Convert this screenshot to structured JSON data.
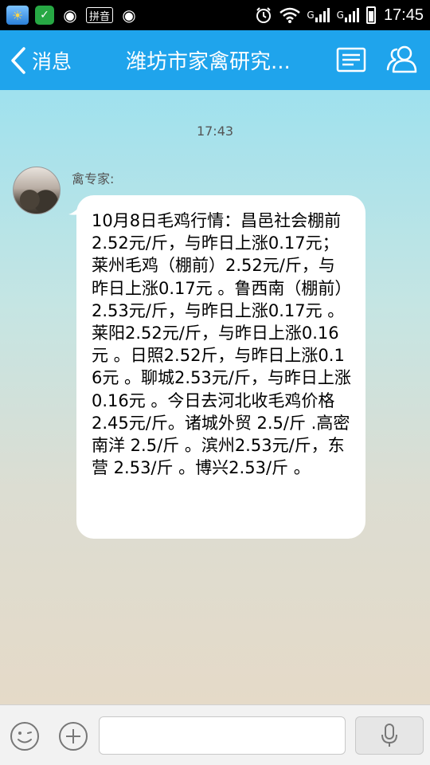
{
  "status_bar": {
    "ime_label": "拼音",
    "network_label_1": "G",
    "network_label_2": "G",
    "time": "17:45"
  },
  "header": {
    "back_label": "消息",
    "title": "潍坊市家禽研究...",
    "icons": [
      "profile-card-icon",
      "group-members-icon"
    ]
  },
  "chat": {
    "timestamp": "17:43",
    "messages": [
      {
        "sender": "禽专家:",
        "text": "10月8日毛鸡行情：昌邑社会棚前2.52元/斤，与昨日上涨0.17元；莱州毛鸡（棚前）2.52元/斤，与昨日上涨0.17元 。鲁西南（棚前）2.53元/斤，与昨日上涨0.17元 。莱阳2.52元/斤，与昨日上涨0.16元 。日照2.52斤，与昨日上涨0.16元 。聊城2.53元/斤，与昨日上涨0.16元 。今日去河北收毛鸡价格 2.45元/斤。诸城外贸 2.5/斤 .高密南洋 2.5/斤 。滨州2.53元/斤，东营 2.53/斤 。博兴2.53/斤 。"
      }
    ]
  },
  "input_bar": {
    "text_value": "",
    "icons": [
      "emoji-icon",
      "plus-icon",
      "microphone-icon"
    ]
  },
  "colors": {
    "header_bg": "#1fa4ec",
    "status_bg": "#000000",
    "bubble_bg": "#ffffff"
  }
}
